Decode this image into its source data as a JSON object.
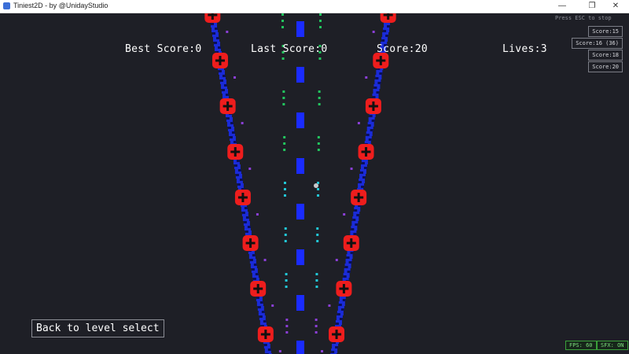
{
  "window": {
    "title": "Tiniest2D - by @UnidayStudio",
    "controls": [
      "—",
      "❐",
      "✕"
    ]
  },
  "hud": {
    "best_score": "Best Score:0",
    "last_score": "Last Score:0",
    "score": "Score:20",
    "lives": "Lives:3",
    "esc_hint": "Press ESC to stop"
  },
  "score_list": [
    "Score:15",
    "Score:16 (36)",
    "Score:18",
    "Score:20"
  ],
  "back_button": "Back to level select",
  "status": {
    "fps": "FPS: 60",
    "sfx": "SFX: ON"
  },
  "colors": {
    "background": "#1e1f26",
    "road_edge": "#1a2bd8",
    "pylon": "#ee1d1d",
    "lane_marker": "#1a2bff",
    "dot_green": "#22c55e",
    "dot_cyan": "#22c7d6",
    "dot_purple": "#8b3fd6"
  }
}
